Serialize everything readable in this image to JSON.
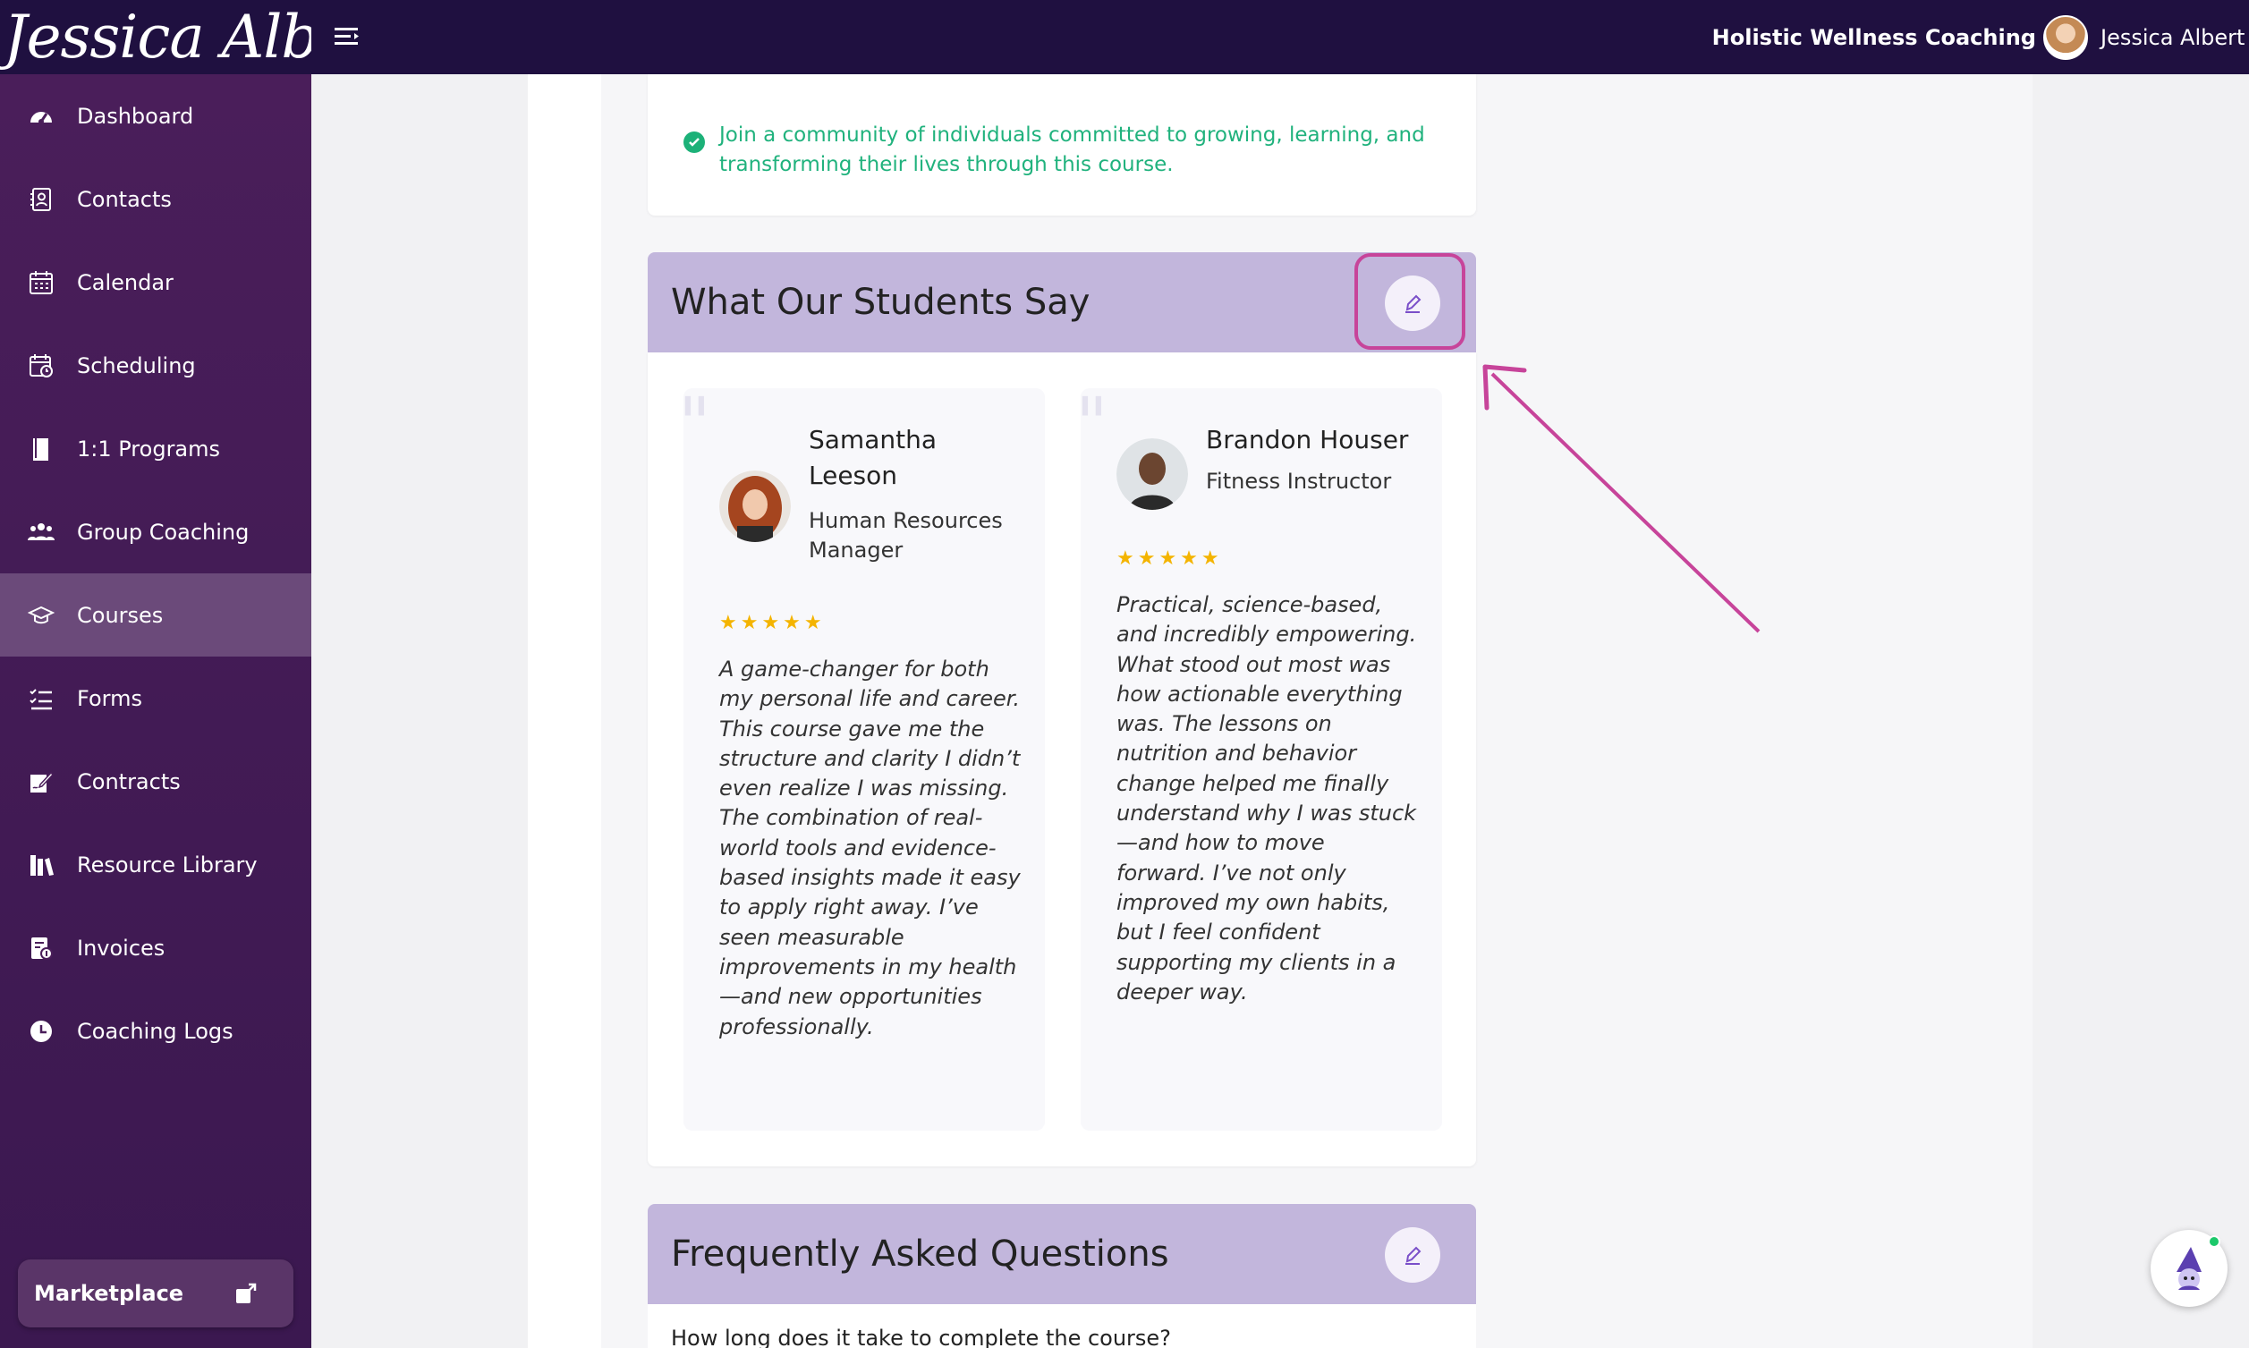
{
  "topbar": {
    "logo_text": "Jessica Albert",
    "business_name": "Holistic Wellness Coaching",
    "user_name": "Jessica Albert"
  },
  "sidebar": {
    "items": [
      {
        "label": "Dashboard",
        "icon": "dashboard-icon"
      },
      {
        "label": "Contacts",
        "icon": "contacts-icon"
      },
      {
        "label": "Calendar",
        "icon": "calendar-icon"
      },
      {
        "label": "Scheduling",
        "icon": "scheduling-icon"
      },
      {
        "label": "1:1 Programs",
        "icon": "book-icon"
      },
      {
        "label": "Group Coaching",
        "icon": "group-icon"
      },
      {
        "label": "Courses",
        "icon": "graduation-cap-icon",
        "active": true
      },
      {
        "label": "Forms",
        "icon": "forms-icon"
      },
      {
        "label": "Contracts",
        "icon": "contract-icon"
      },
      {
        "label": "Resource Library",
        "icon": "library-icon"
      },
      {
        "label": "Invoices",
        "icon": "invoice-icon"
      },
      {
        "label": "Coaching Logs",
        "icon": "clock-icon"
      }
    ],
    "marketplace_label": "Marketplace"
  },
  "benefit": {
    "text": "Join a community of individuals committed to growing, learning, and transforming their lives through this course."
  },
  "testimonials_section": {
    "title": "What Our Students Say",
    "items": [
      {
        "name": "Samantha Leeson",
        "role": "Human Resources Manager",
        "rating": 5,
        "text": "A game-changer for both my personal life and career. This course gave me the structure and clarity I didn’t even realize I was missing. The combination of real-world tools and evidence-based insights made it easy to apply right away. I’ve seen measurable improvements in my health—and new opportunities professionally."
      },
      {
        "name": "Brandon Houser",
        "role": "Fitness Instructor",
        "rating": 5,
        "text": "Practical, science-based, and incredibly empowering. What stood out most was how actionable everything was. The lessons on nutrition and behavior change helped me finally understand why I was stuck—and how to move forward. I’ve not only improved my own habits, but I feel confident supporting my clients in a deeper way."
      }
    ]
  },
  "faq_section": {
    "title": "Frequently Asked Questions",
    "first_question": "How long does it take to complete the course?"
  },
  "colors": {
    "topbar": "#1f1040",
    "sidebar": "#4a1e5a",
    "section_header": "#c2b6dc",
    "accent_green": "#20b27d",
    "highlight": "#c7449a",
    "star": "#f4b400"
  }
}
